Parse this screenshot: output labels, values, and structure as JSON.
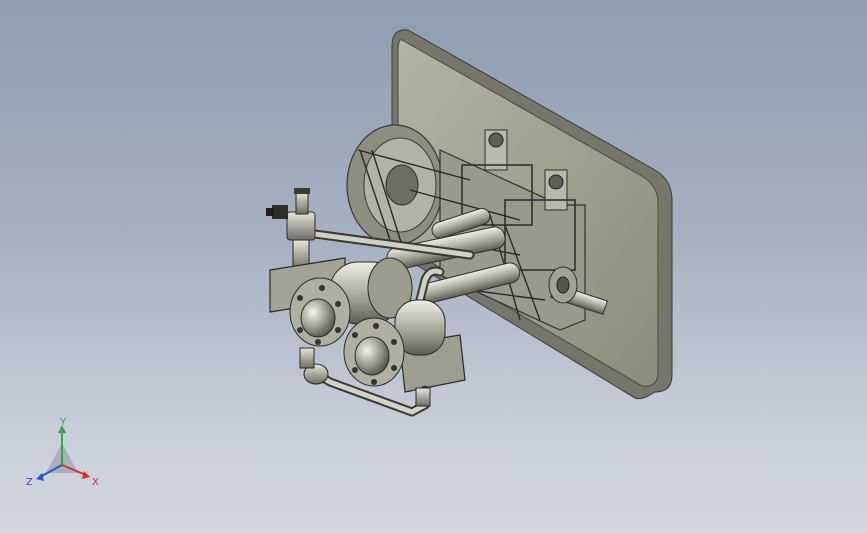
{
  "viewport": {
    "background_top": "#8f9db1",
    "background_bottom": "#d3d7de",
    "model_body_color": "#a8a896",
    "plate_color": "#9a9a86"
  },
  "triad": {
    "x_label": "X",
    "y_label": "Y",
    "z_label": "Z",
    "x_color": "#d93025",
    "y_color": "#2fa84f",
    "z_color": "#2956c8"
  }
}
